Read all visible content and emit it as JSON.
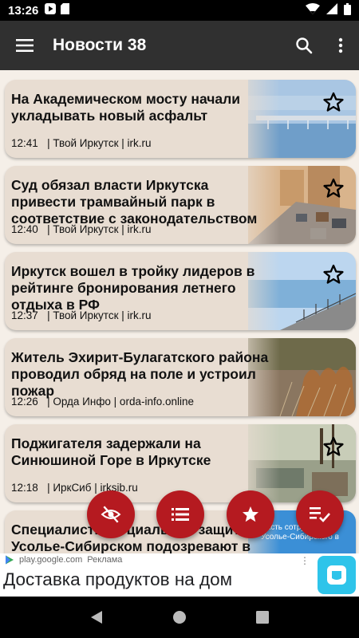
{
  "status_bar": {
    "time": "13:26"
  },
  "app_bar": {
    "title": "Новости 38"
  },
  "news": [
    {
      "title": "На Академическом мосту начали укладывать новый асфальт",
      "time": "12:41",
      "source": "| Твой Иркутск | irk.ru",
      "image": "bridge-photo"
    },
    {
      "title": "Суд обязал власти Иркутска привести трамвайный парк в соответствие с законодательством",
      "time": "12:40",
      "source": "| Твой Иркутск | irk.ru",
      "image": "traffic-street-photo"
    },
    {
      "title": "Иркутск вошел в тройку лидеров в рейтинге бронирования летнего отдыха в РФ",
      "time": "12:37",
      "source": "| Твой Иркутск | irk.ru",
      "image": "embankment-photo"
    },
    {
      "title": "Житель Эхирит-Булагатского района проводил обряд на поле и устроил пожар",
      "time": "12:26",
      "source": "| Орда Инфо | orda-info.online",
      "image": "grass-fire-photo"
    },
    {
      "title": "Поджигателя задержали на Синюшиной Горе в Иркутске",
      "time": "12:18",
      "source": "| ИркСиб | irksib.ru",
      "image": "yard-photo"
    },
    {
      "title": "Специалисты социальной защиты Усолье-Сибирском подозревают в мошенничестве с детскими пособиями",
      "image_text": "Часть сотрудников Усолье-Сибирского в"
    }
  ],
  "fabs": [
    {
      "name": "hide-read-button",
      "icon": "eye-off-icon"
    },
    {
      "name": "list-button",
      "icon": "list-icon"
    },
    {
      "name": "favorites-button",
      "icon": "star-icon"
    },
    {
      "name": "mark-read-button",
      "icon": "playlist-check-icon"
    }
  ],
  "ad": {
    "domain": "play.google.com",
    "label": "Реклама",
    "title": "Доставка продуктов на дом",
    "more": "⋮"
  },
  "colors": {
    "app_bar": "#303030",
    "card": "#e8ddd2",
    "fab": "#b51a20",
    "background": "#f5efe8"
  }
}
